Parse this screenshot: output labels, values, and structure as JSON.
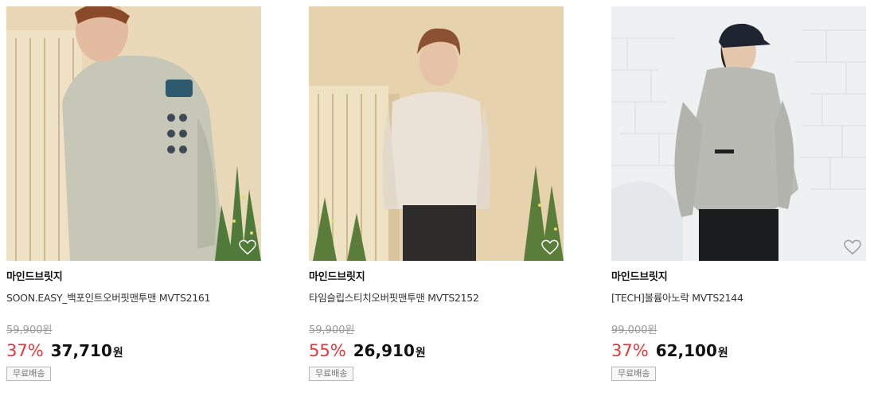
{
  "products": [
    {
      "brand": "마인드브릿지",
      "name": "SOON.EASY_백포인트오버핏맨투맨 MVTS2161",
      "original_price": "59,900원",
      "discount": "37%",
      "sale_price": "37,710",
      "currency": "원",
      "badge": "무료배송",
      "image_icon": "product-photo-sweatshirt-back-print"
    },
    {
      "brand": "마인드브릿지",
      "name": "타임슬립스티치오버핏맨투맨 MVTS2152",
      "original_price": "59,900원",
      "discount": "55%",
      "sale_price": "26,910",
      "currency": "원",
      "badge": "무료배송",
      "image_icon": "product-photo-sweatshirt-front"
    },
    {
      "brand": "마인드브릿지",
      "name": "[TECH]볼륨아노락 MVTS2144",
      "original_price": "99,000원",
      "discount": "37%",
      "sale_price": "62,100",
      "currency": "원",
      "badge": "무료배송",
      "image_icon": "product-photo-anorak"
    }
  ],
  "colors": {
    "discount": "#e8363a",
    "price": "#111111",
    "original_price": "#9a9a9a"
  },
  "wish_icon": "heart-outline-icon"
}
